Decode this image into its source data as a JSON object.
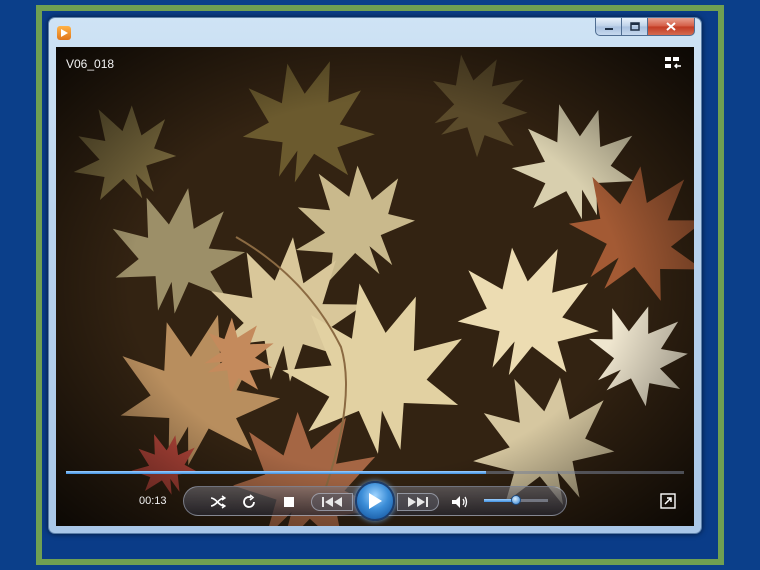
{
  "window": {
    "app_icon": "media-player-icon",
    "caption_buttons": [
      "minimize-icon",
      "maximize-icon",
      "close-icon"
    ]
  },
  "video": {
    "title": "V06_018",
    "scene": "autumn-maple-leaves"
  },
  "controls": {
    "elapsed_time": "00:13",
    "seek_progress": 0.68,
    "volume_level": 0.5,
    "icons": [
      "shuffle-icon",
      "repeat-icon",
      "stop-icon",
      "previous-icon",
      "play-icon",
      "next-icon",
      "volume-icon",
      "switch-to-library-icon",
      "fullscreen-icon"
    ]
  },
  "colors": {
    "desktop": "#0b3f8a",
    "frame_green": "#6f9f52",
    "accent_blue": "#3f8fe0"
  }
}
